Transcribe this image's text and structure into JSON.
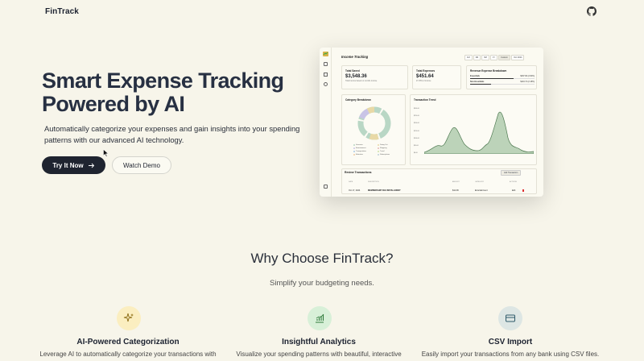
{
  "nav": {
    "logo": "FinTrack",
    "github_icon": "github-icon"
  },
  "hero": {
    "title_line1": "Smart Expense Tracking",
    "title_line2": "Powered by AI",
    "subtitle": "Automatically categorize your expenses and gain insights into your spending patterns with our advanced AI technology.",
    "primary_button": "Try It Now",
    "secondary_button": "Watch Demo"
  },
  "dashboard": {
    "title": "Income Tracking",
    "ranges": [
      "1M",
      "3M",
      "6M",
      "1Y",
      "Custom"
    ],
    "date_label": "Oct 2024",
    "total_saved": {
      "label": "Total Saved",
      "value": "$3,548.36",
      "sub": "Total Income based on months income"
    },
    "total_expenses": {
      "label": "Total Expenses",
      "value": "$451.64",
      "sub": "27.25% of income"
    },
    "revenue": {
      "label": "Revenue Expense Breakdown",
      "rows": [
        {
          "name": "Essentials",
          "value": "$307.96 (2.82%)"
        },
        {
          "name": "Non-Essentials",
          "value": "$143.74 (2.18%)"
        }
      ]
    },
    "category": {
      "label": "Category Breakdown",
      "legend": [
        "Groceries",
        "Dining Out",
        "Entertainment",
        "Shopping",
        "Transportation",
        "Travel",
        "Education",
        "Subscriptions"
      ]
    },
    "trend": {
      "label": "Transaction Trend",
      "y_ticks": [
        "$300.00",
        "$250.00",
        "$200.00",
        "$150.00",
        "$100.00",
        "$50.00",
        "$0.00"
      ]
    },
    "transactions": {
      "label": "Review Transactions",
      "add_button": "Add Transaction",
      "headers": [
        "DATE",
        "DESCRIPTION",
        "AMOUNT",
        "CATEGORY",
        "ACTIONS"
      ],
      "row": {
        "date": "Oct 17, 2024",
        "description": "MEMBERSHIP FEE INSTALLMENT",
        "amount": "$12.99",
        "category": "Entertainment",
        "action": "Edit"
      }
    }
  },
  "why": {
    "title": "Why Choose FinTrack?",
    "subtitle": "Simplify your budgeting needs.",
    "features": [
      {
        "title": "AI-Powered Categorization",
        "desc": "Leverage AI to automatically categorize your transactions with",
        "icon": "sparkles-icon",
        "color": "#fbeec0"
      },
      {
        "title": "Insightful Analytics",
        "desc": "Visualize your spending patterns with beautiful, interactive",
        "icon": "chart-icon",
        "color": "#d8f0d8"
      },
      {
        "title": "CSV Import",
        "desc": "Easily import your transactions from any bank using CSV files.",
        "icon": "card-icon",
        "color": "#dde6e4"
      }
    ]
  }
}
